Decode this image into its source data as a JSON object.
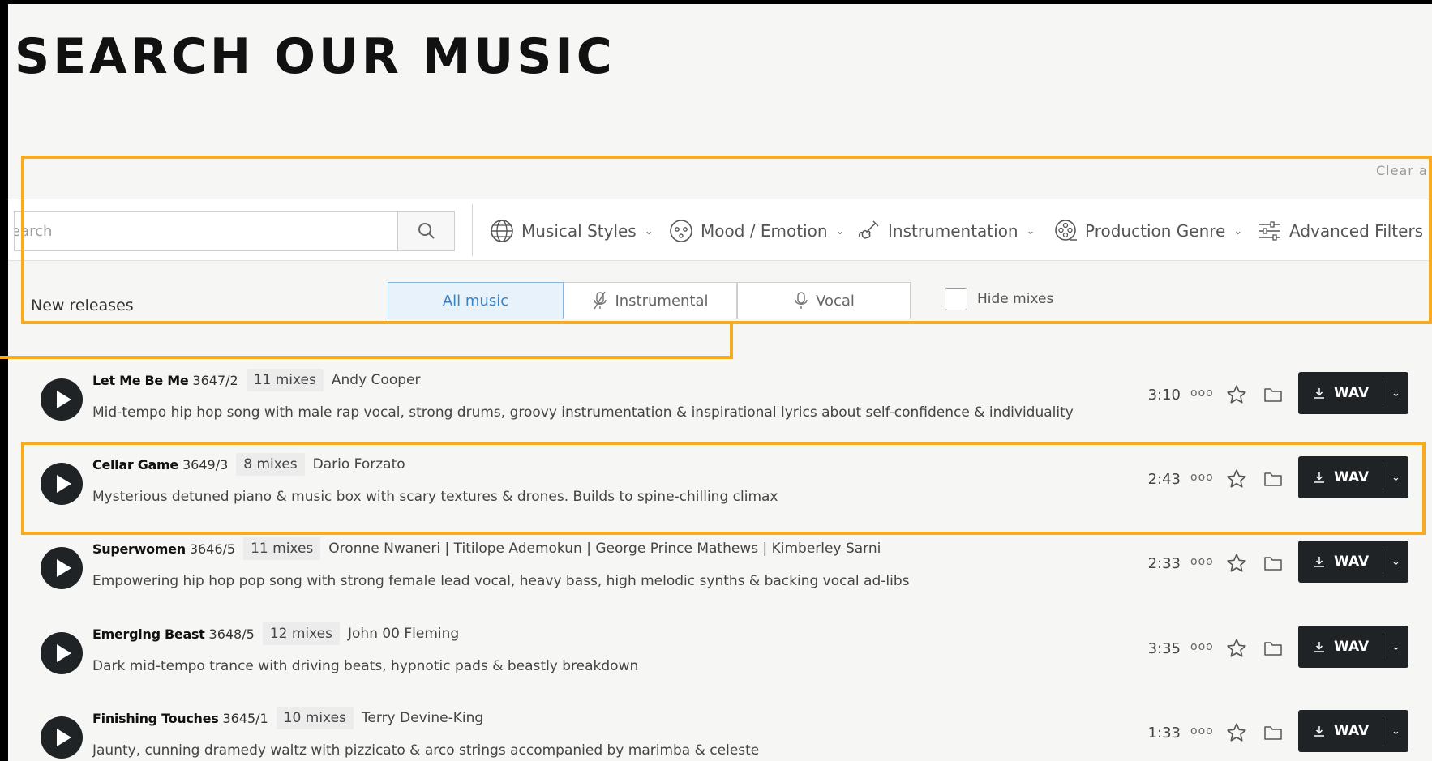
{
  "page_title": "SEARCH OUR MUSIC",
  "clear_all": "Clear all",
  "search": {
    "placeholder": "earch"
  },
  "filters": [
    {
      "label": "Musical Styles",
      "icon": "globe-icon"
    },
    {
      "label": "Mood / Emotion",
      "icon": "face-icon"
    },
    {
      "label": "Instrumentation",
      "icon": "violin-icon"
    },
    {
      "label": "Production Genre",
      "icon": "film-reel-icon"
    },
    {
      "label": "Advanced Filters",
      "icon": "sliders-icon"
    }
  ],
  "new_releases": "New releases",
  "tabs": [
    {
      "label": "All music",
      "active": true
    },
    {
      "label": "Instrumental",
      "icon": "mic-off-icon"
    },
    {
      "label": "Vocal",
      "icon": "mic-icon"
    }
  ],
  "hide_mixes": "Hide mixes",
  "download_label": "WAV",
  "more_label": "ooo",
  "tracks": [
    {
      "name": "Let Me Be Me",
      "code": "3647/2",
      "mixes": "11 mixes",
      "artist": "Andy Cooper",
      "description": "Mid-tempo hip hop song with male rap vocal, strong drums, groovy instrumentation & inspirational lyrics about self-confidence & individuality",
      "duration": "3:10"
    },
    {
      "name": "Cellar Game",
      "code": "3649/3",
      "mixes": "8 mixes",
      "artist": "Dario Forzato",
      "description": "Mysterious detuned piano & music box with scary textures & drones. Builds to spine-chilling climax",
      "duration": "2:43"
    },
    {
      "name": "Superwomen",
      "code": "3646/5",
      "mixes": "11 mixes",
      "artist": "Oronne Nwaneri | Titilope Ademokun | George Prince Mathews | Kimberley Sarni",
      "description": "Empowering hip hop pop song with strong female lead vocal, heavy bass, high melodic synths & backing vocal ad-libs",
      "duration": "2:33"
    },
    {
      "name": "Emerging Beast",
      "code": "3648/5",
      "mixes": "12 mixes",
      "artist": "John 00 Fleming",
      "description": "Dark mid-tempo trance with driving beats, hypnotic pads & beastly breakdown",
      "duration": "3:35"
    },
    {
      "name": "Finishing Touches",
      "code": "3645/1",
      "mixes": "10 mixes",
      "artist": "Terry Devine-King",
      "description": "Jaunty, cunning dramedy waltz with pizzicato & arco strings accompanied by marimba & celeste",
      "duration": "1:33"
    }
  ],
  "colors": {
    "highlight": "#f5ac22",
    "button_dark": "#1f2326",
    "active_tab": "#3a83c2"
  }
}
